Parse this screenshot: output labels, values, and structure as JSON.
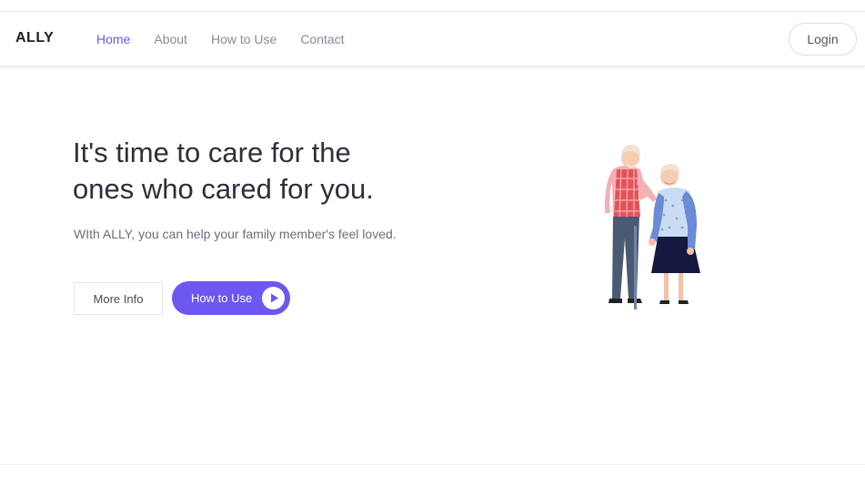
{
  "header": {
    "brand": "ALLY",
    "nav": [
      {
        "label": "Home",
        "active": true
      },
      {
        "label": "About",
        "active": false
      },
      {
        "label": "How to Use",
        "active": false
      },
      {
        "label": "Contact",
        "active": false
      }
    ],
    "login_label": "Login"
  },
  "hero": {
    "title_line1": "It's time to care for the",
    "title_line2": "ones who cared for you.",
    "subtitle": "WIth ALLY, you can help your family member's feel loved.",
    "more_info_label": "More Info",
    "how_to_use_label": "How to Use",
    "play_icon": "play-icon",
    "illustration": "elderly-couple-illustration"
  },
  "colors": {
    "accent": "#6c57f0",
    "nav_active": "#6a55e8",
    "text_dark": "#2f2f3a",
    "text_muted": "#8a8a96"
  }
}
